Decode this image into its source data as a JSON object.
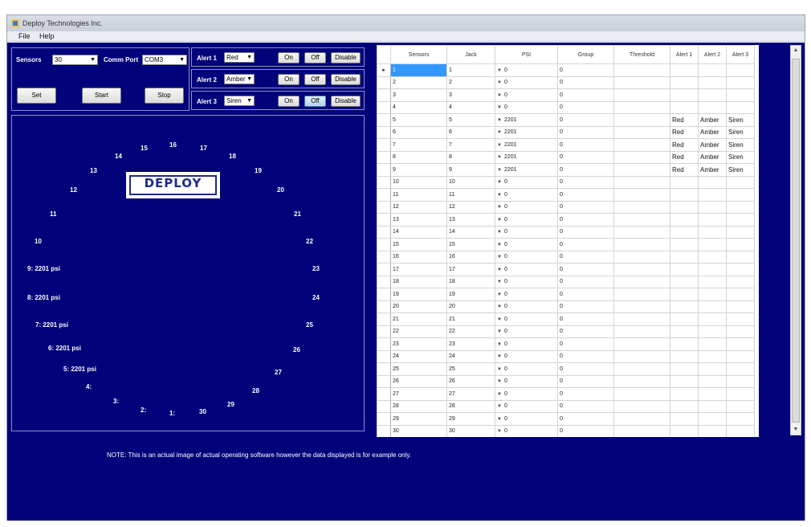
{
  "window": {
    "title": "Deploy Technologies Inc."
  },
  "menu": [
    "File",
    "Help"
  ],
  "controls": {
    "sensors_label": "Sensors",
    "sensors_value": "30",
    "comm_port_label": "Comm Port",
    "comm_port_value": "COM3",
    "set_label": "Set",
    "start_label": "Start",
    "stop_label": "Stop",
    "alerts": [
      {
        "label": "Alert 1",
        "value": "Red",
        "on": "On",
        "off": "Off",
        "disable": "Disable"
      },
      {
        "label": "Alert 2",
        "value": "Amber",
        "on": "On",
        "off": "Off",
        "disable": "Disable"
      },
      {
        "label": "Alert 3",
        "value": "Siren",
        "on": "On",
        "off": "Off",
        "disable": "Disable"
      }
    ]
  },
  "gauge": {
    "logo": "DEPLOY",
    "sensors": [
      "1:",
      "2:",
      "3:",
      "4:",
      "5:  2201 psi",
      "6:  2201 psi",
      "7:  2201 psi",
      "8:  2201 psi",
      "9:  2201 psi",
      "10",
      "11",
      "12",
      "13",
      "14",
      "15",
      "16",
      "17",
      "18",
      "19",
      "20",
      "21",
      "22",
      "23",
      "24",
      "25",
      "26",
      "27",
      "28",
      "29",
      "30"
    ]
  },
  "note": "NOTE:  This is an actual image of actual operating software however the data displayed is for example only.",
  "grid": {
    "columns": [
      "Sensors",
      "Jack",
      "PSI",
      "Group",
      "Threshold",
      "Alert 1",
      "Alert 2",
      "Alert 3"
    ],
    "rows": [
      [
        "1",
        "1",
        "0",
        "0",
        "",
        "",
        "",
        ""
      ],
      [
        "2",
        "2",
        "0",
        "0",
        "",
        "",
        "",
        ""
      ],
      [
        "3",
        "3",
        "0",
        "0",
        "",
        "",
        "",
        ""
      ],
      [
        "4",
        "4",
        "0",
        "0",
        "",
        "",
        "",
        ""
      ],
      [
        "5",
        "5",
        "2201",
        "0",
        "",
        "Red",
        "Amber",
        "Siren"
      ],
      [
        "6",
        "6",
        "2201",
        "0",
        "",
        "Red",
        "Amber",
        "Siren"
      ],
      [
        "7",
        "7",
        "2201",
        "0",
        "",
        "Red",
        "Amber",
        "Siren"
      ],
      [
        "8",
        "8",
        "2201",
        "0",
        "",
        "Red",
        "Amber",
        "Siren"
      ],
      [
        "9",
        "9",
        "2201",
        "0",
        "",
        "Red",
        "Amber",
        "Siren"
      ],
      [
        "10",
        "10",
        "0",
        "0",
        "",
        "",
        "",
        ""
      ],
      [
        "11",
        "11",
        "0",
        "0",
        "",
        "",
        "",
        ""
      ],
      [
        "12",
        "12",
        "0",
        "0",
        "",
        "",
        "",
        ""
      ],
      [
        "13",
        "13",
        "0",
        "0",
        "",
        "",
        "",
        ""
      ],
      [
        "14",
        "14",
        "0",
        "0",
        "",
        "",
        "",
        ""
      ],
      [
        "15",
        "15",
        "0",
        "0",
        "",
        "",
        "",
        ""
      ],
      [
        "16",
        "16",
        "0",
        "0",
        "",
        "",
        "",
        ""
      ],
      [
        "17",
        "17",
        "0",
        "0",
        "",
        "",
        "",
        ""
      ],
      [
        "18",
        "18",
        "0",
        "0",
        "",
        "",
        "",
        ""
      ],
      [
        "19",
        "19",
        "0",
        "0",
        "",
        "",
        "",
        ""
      ],
      [
        "20",
        "20",
        "0",
        "0",
        "",
        "",
        "",
        ""
      ],
      [
        "21",
        "21",
        "0",
        "0",
        "",
        "",
        "",
        ""
      ],
      [
        "22",
        "22",
        "0",
        "0",
        "",
        "",
        "",
        ""
      ],
      [
        "23",
        "23",
        "0",
        "0",
        "",
        "",
        "",
        ""
      ],
      [
        "24",
        "24",
        "0",
        "0",
        "",
        "",
        "",
        ""
      ],
      [
        "25",
        "25",
        "0",
        "0",
        "",
        "",
        "",
        ""
      ],
      [
        "26",
        "26",
        "0",
        "0",
        "",
        "",
        "",
        ""
      ],
      [
        "27",
        "27",
        "0",
        "0",
        "",
        "",
        "",
        ""
      ],
      [
        "28",
        "28",
        "0",
        "0",
        "",
        "",
        "",
        ""
      ],
      [
        "29",
        "29",
        "0",
        "0",
        "",
        "",
        "",
        ""
      ],
      [
        "30",
        "30",
        "0",
        "0",
        "",
        "",
        "",
        ""
      ]
    ]
  },
  "colors": {
    "background": "#02027a",
    "selection": "#3399ff"
  }
}
